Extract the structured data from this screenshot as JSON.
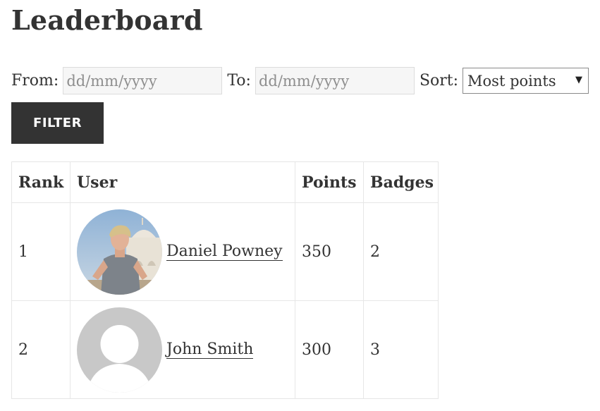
{
  "page_title": "Leaderboard",
  "filters": {
    "from_label": "From:",
    "from_placeholder": "dd/mm/yyyy",
    "to_label": "To:",
    "to_placeholder": "dd/mm/yyyy",
    "sort_label": "Sort:",
    "sort_selected": "Most points",
    "filter_button": "FILTER"
  },
  "table": {
    "headers": [
      "Rank",
      "User",
      "Points",
      "Badges"
    ],
    "rows": [
      {
        "rank": "1",
        "user": "Daniel Powney",
        "points": "350",
        "badges": "2",
        "avatar": "photo-avatar"
      },
      {
        "rank": "2",
        "user": "John Smith",
        "points": "300",
        "badges": "3",
        "avatar": "default-avatar"
      }
    ]
  },
  "colors": {
    "text": "#333333",
    "button_bg": "#333333",
    "button_text": "#ffffff",
    "input_bg": "#f6f6f6",
    "border": "#e6e6e6",
    "placeholder_avatar": "#c8c8c8"
  }
}
